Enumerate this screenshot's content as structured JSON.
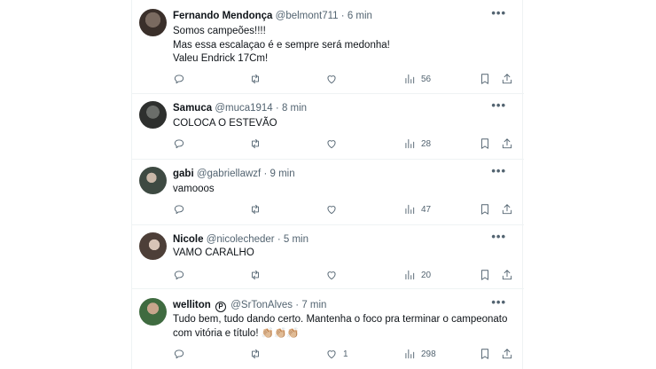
{
  "replies": [
    {
      "name": "Fernando Mendonça",
      "handle": "@belmont711",
      "separator": "·",
      "time": "6 min",
      "text": "Somos campeões!!!!\nMas essa escalaçao é e sempre será medonha!\nValeu Endrick 17Cm!",
      "likes": "",
      "views": "56",
      "avatar_color": "#4a3c36"
    },
    {
      "name": "Samuca",
      "handle": "@muca1914",
      "separator": "·",
      "time": "8 min",
      "text": "COLOCA O ESTEVÃO",
      "likes": "",
      "views": "28",
      "avatar_color": "#3b3e3b"
    },
    {
      "name": "gabi",
      "handle": "@gabriellawzf",
      "separator": "·",
      "time": "9 min",
      "text": "vamooos",
      "likes": "",
      "views": "47",
      "avatar_color": "#5f6e62"
    },
    {
      "name": "Nicole",
      "handle": "@nicolecheder",
      "separator": "·",
      "time": "5 min",
      "text": "VAMO CARALHO",
      "likes": "",
      "views": "20",
      "avatar_color": "#6a5a52"
    },
    {
      "name": "welliton",
      "badge": "P",
      "handle": "@SrTonAlves",
      "separator": "·",
      "time": "7 min",
      "text": "Tudo bem, tudo dando certo. Mantenha o foco pra terminar o campeonato\ncom vitória e título! 👏🏼👏🏼👏🏼",
      "likes": "1",
      "views": "298",
      "avatar_color": "#4f7a4e"
    }
  ],
  "icons": {
    "reply": "reply-icon",
    "repost": "repost-icon",
    "like": "like-icon",
    "views": "views-icon",
    "bookmark": "bookmark-icon",
    "share": "share-icon",
    "more": "more-icon"
  },
  "more_glyph": "•••"
}
